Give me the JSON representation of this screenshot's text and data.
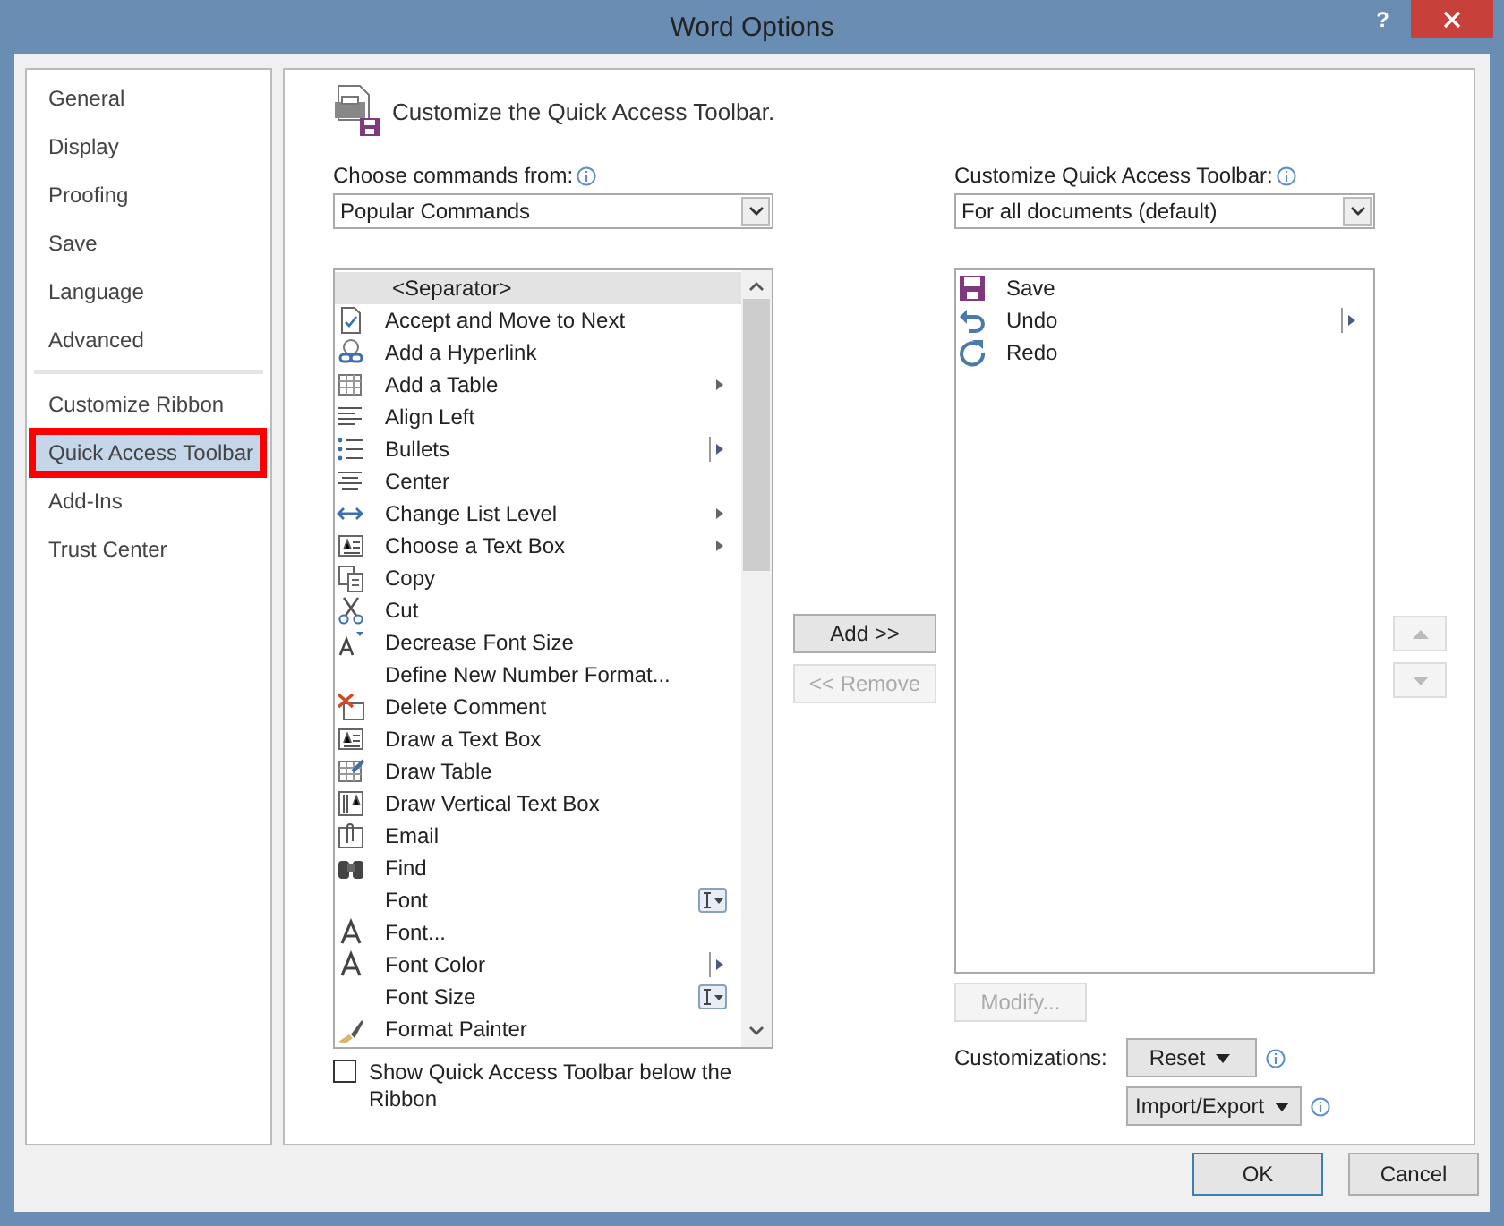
{
  "window": {
    "title": "Word Options",
    "help": "?"
  },
  "sidebar": {
    "items": [
      {
        "label": "General",
        "selected": false
      },
      {
        "label": "Display",
        "selected": false
      },
      {
        "label": "Proofing",
        "selected": false
      },
      {
        "label": "Save",
        "selected": false
      },
      {
        "label": "Language",
        "selected": false
      },
      {
        "label": "Advanced",
        "selected": false,
        "divider_after": true
      },
      {
        "label": "Customize Ribbon",
        "selected": false
      },
      {
        "label": "Quick Access Toolbar",
        "selected": true
      },
      {
        "label": "Add-Ins",
        "selected": false
      },
      {
        "label": "Trust Center",
        "selected": false
      }
    ]
  },
  "heading": "Customize the Quick Access Toolbar.",
  "commands": {
    "label": "Choose commands from:",
    "value": "Popular Commands",
    "items": [
      {
        "label": "<Separator>",
        "selected": true,
        "kind": "separator"
      },
      {
        "label": "Accept and Move to Next",
        "selected": false,
        "kind": "plain"
      },
      {
        "label": "Add a Hyperlink",
        "selected": false,
        "kind": "plain"
      },
      {
        "label": "Add a Table",
        "selected": false,
        "kind": "submenu"
      },
      {
        "label": "Align Left",
        "selected": false,
        "kind": "plain"
      },
      {
        "label": "Bullets",
        "selected": false,
        "kind": "split"
      },
      {
        "label": "Center",
        "selected": false,
        "kind": "plain"
      },
      {
        "label": "Change List Level",
        "selected": false,
        "kind": "submenu"
      },
      {
        "label": "Choose a Text Box",
        "selected": false,
        "kind": "submenu"
      },
      {
        "label": "Copy",
        "selected": false,
        "kind": "plain"
      },
      {
        "label": "Cut",
        "selected": false,
        "kind": "plain"
      },
      {
        "label": "Decrease Font Size",
        "selected": false,
        "kind": "plain"
      },
      {
        "label": "Define New Number Format...",
        "selected": false,
        "kind": "plain"
      },
      {
        "label": "Delete Comment",
        "selected": false,
        "kind": "plain"
      },
      {
        "label": "Draw a Text Box",
        "selected": false,
        "kind": "plain"
      },
      {
        "label": "Draw Table",
        "selected": false,
        "kind": "plain"
      },
      {
        "label": "Draw Vertical Text Box",
        "selected": false,
        "kind": "plain"
      },
      {
        "label": "Email",
        "selected": false,
        "kind": "plain"
      },
      {
        "label": "Find",
        "selected": false,
        "kind": "plain"
      },
      {
        "label": "Font",
        "selected": false,
        "kind": "picker"
      },
      {
        "label": "Font...",
        "selected": false,
        "kind": "plain"
      },
      {
        "label": "Font Color",
        "selected": false,
        "kind": "split"
      },
      {
        "label": "Font Size",
        "selected": false,
        "kind": "picker"
      },
      {
        "label": "Format Painter",
        "selected": false,
        "kind": "plain"
      }
    ]
  },
  "show_below": {
    "label": "Show Quick Access Toolbar below the Ribbon",
    "checked": false
  },
  "add_button": {
    "label": "Add >>",
    "disabled": false
  },
  "remove_button": {
    "label": "<< Remove",
    "disabled": true
  },
  "toolbar": {
    "label": "Customize Quick Access Toolbar:",
    "value": "For all documents (default)",
    "items": [
      {
        "label": "Save",
        "selected": false,
        "kind": "plain"
      },
      {
        "label": "Undo",
        "selected": false,
        "kind": "split"
      },
      {
        "label": "Redo",
        "selected": false,
        "kind": "plain"
      }
    ]
  },
  "move_up": {
    "disabled": true
  },
  "move_down": {
    "disabled": true
  },
  "modify_button": {
    "label": "Modify...",
    "disabled": true
  },
  "customizations": {
    "label": "Customizations:",
    "reset": "Reset",
    "import_export": "Import/Export"
  },
  "buttons": [
    "OK",
    "Cancel"
  ]
}
